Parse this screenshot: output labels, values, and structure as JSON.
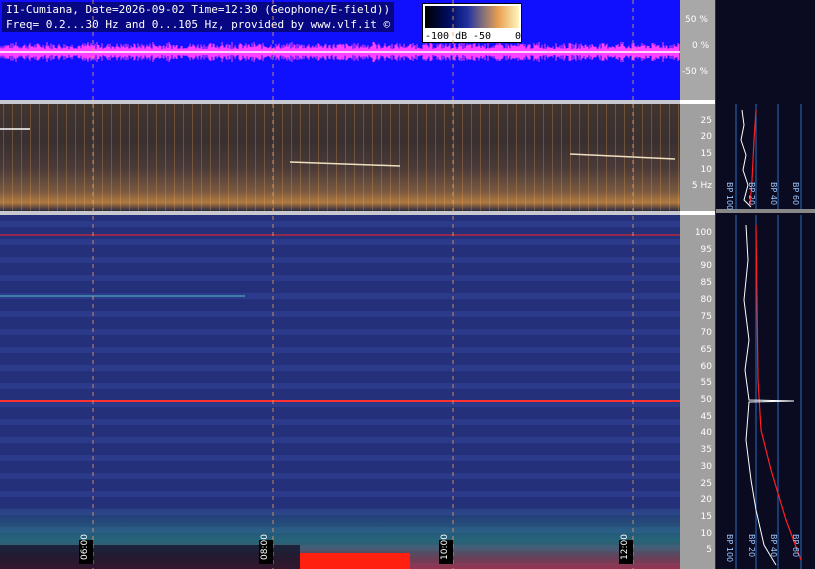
{
  "header": {
    "line1": "I1-Cumiana, Date=2026-09-02 Time=12:30 (Geophone/E-field))",
    "line2": "Freq= 0.2...30 Hz and 0...105 Hz, provided by www.vlf.it ©"
  },
  "colorbar": {
    "labels": [
      "-100 dB",
      "-50",
      "0"
    ]
  },
  "waveform": {
    "scale_labels": [
      "50 %",
      "0 %",
      "-50 %"
    ],
    "trace_color": "#ff40ff",
    "background_color": "#1010ff"
  },
  "upper_spectrogram": {
    "axis_labels": [
      "25",
      "20",
      "15",
      "10",
      "5 Hz"
    ],
    "range_hz": [
      0.2,
      30
    ]
  },
  "lower_spectrogram": {
    "axis_labels": [
      "100",
      "95",
      "90",
      "85",
      "80",
      "75",
      "70",
      "65",
      "60",
      "55",
      "50",
      "45",
      "40",
      "35",
      "30",
      "25",
      "20",
      "15",
      "10",
      "5"
    ],
    "range_hz": [
      0,
      105
    ],
    "mains_line_hz": 50,
    "marker_line_hz": 100
  },
  "time_labels": [
    "06:00",
    "08:00",
    "10:00",
    "12:00"
  ],
  "profile_panel": {
    "upper_bp_labels": [
      "BP 100",
      "BP 20",
      "BP 40",
      "BP 60"
    ],
    "lower_bp_labels": [
      "BP 100",
      "BP 20",
      "BP 40",
      "BP 60"
    ]
  },
  "colors": {
    "trace": "#ffffff",
    "fit": "#ff2020",
    "grid": "#38a8ff",
    "cursor": "#f0a060"
  }
}
